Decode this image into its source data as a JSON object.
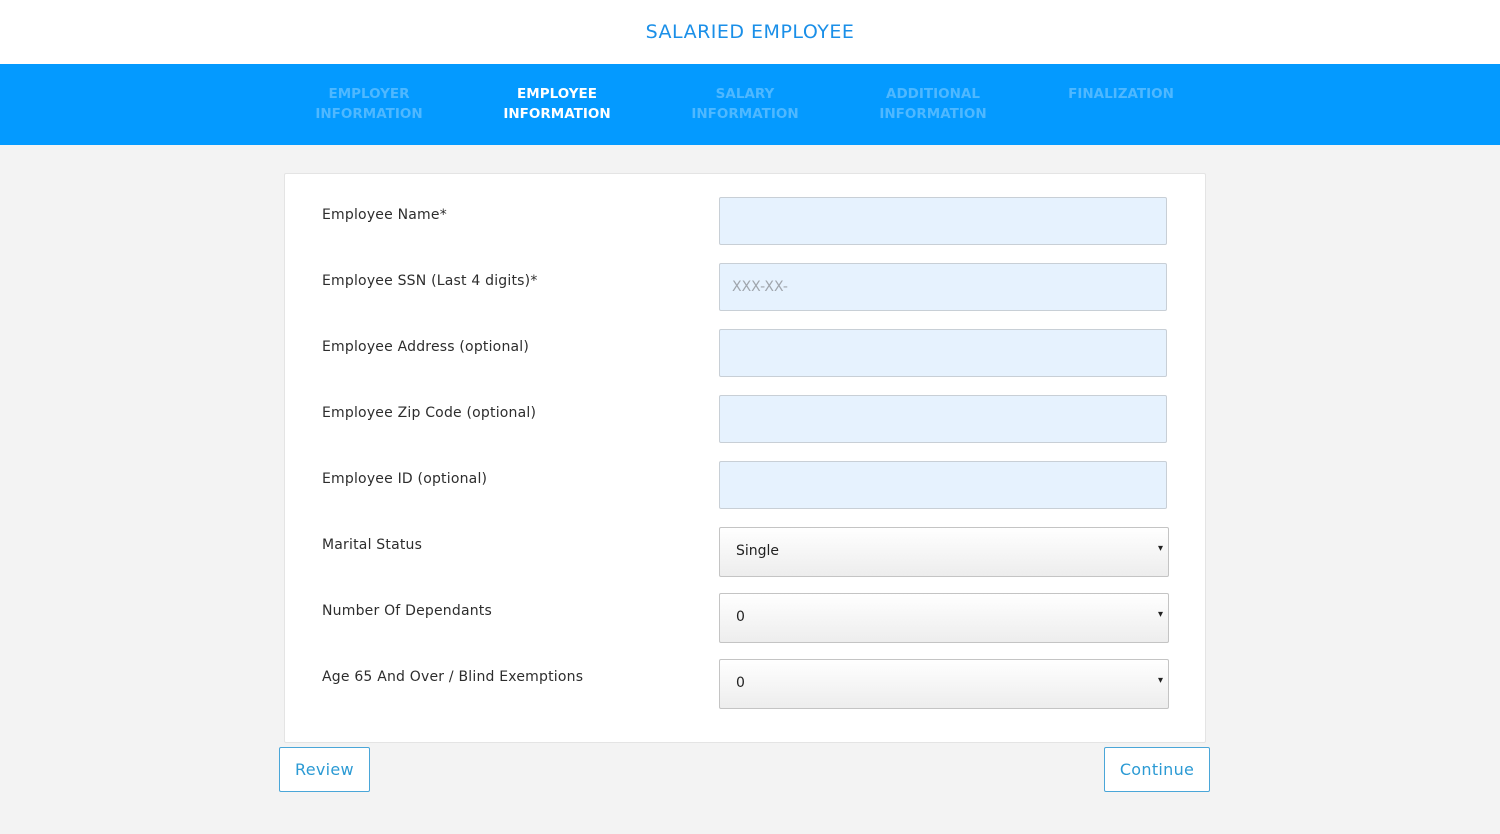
{
  "header": {
    "title": "SALARIED EMPLOYEE"
  },
  "steps": [
    {
      "line1": "EMPLOYER",
      "line2": "INFORMATION",
      "active": false
    },
    {
      "line1": "EMPLOYEE",
      "line2": "INFORMATION",
      "active": true
    },
    {
      "line1": "SALARY",
      "line2": "INFORMATION",
      "active": false
    },
    {
      "line1": "ADDITIONAL",
      "line2": "INFORMATION",
      "active": false
    },
    {
      "line1": "FINALIZATION",
      "line2": "",
      "active": false
    }
  ],
  "form": {
    "employee_name": {
      "label": "Employee Name*",
      "value": "",
      "placeholder": ""
    },
    "employee_ssn": {
      "label": "Employee SSN (Last 4 digits)*",
      "value": "",
      "placeholder": "XXX-XX-"
    },
    "employee_address": {
      "label": "Employee Address (optional)",
      "value": "",
      "placeholder": ""
    },
    "employee_zip": {
      "label": "Employee Zip Code (optional)",
      "value": "",
      "placeholder": ""
    },
    "employee_id": {
      "label": "Employee ID (optional)",
      "value": "",
      "placeholder": ""
    },
    "marital_status": {
      "label": "Marital Status",
      "value": "Single"
    },
    "dependants": {
      "label": "Number Of Dependants",
      "value": "0"
    },
    "exemptions": {
      "label": "Age 65 And Over / Blind Exemptions",
      "value": "0"
    }
  },
  "buttons": {
    "review": "Review",
    "continue": "Continue"
  },
  "icons": {
    "dropdown_arrow": "▾"
  },
  "colors": {
    "accent": "#049aff",
    "title": "#1a8fe8",
    "field_bg": "#e6f2fe"
  }
}
